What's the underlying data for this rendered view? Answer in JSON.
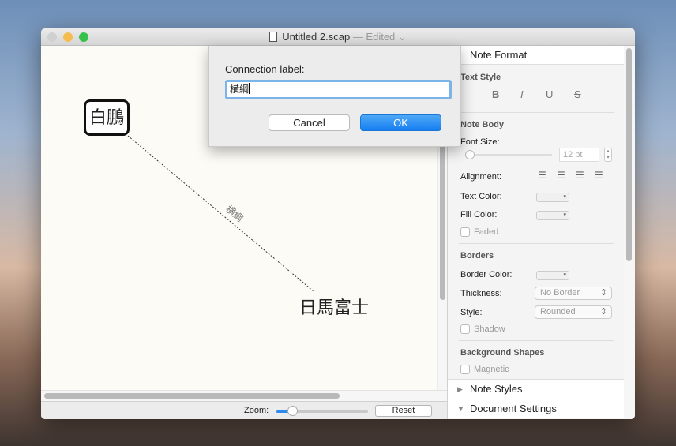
{
  "window": {
    "title": "Untitled 2.scap",
    "status": "— Edited ⌄"
  },
  "canvas": {
    "node1": "白鵬",
    "node2": "日馬富士",
    "connection_label": "横綱"
  },
  "bottom": {
    "zoom_label": "Zoom:",
    "zoom_fraction": 0.15,
    "reset": "Reset"
  },
  "sidebar": {
    "header": "Note Format",
    "text_style": "Text Style",
    "formats": [
      "B",
      "I",
      "U",
      "S"
    ],
    "note_body": "Note Body",
    "font_size": "Font Size:",
    "font_size_value": "12 pt",
    "alignment": "Alignment:",
    "text_color": "Text Color:",
    "fill_color": "Fill Color:",
    "faded": "Faded",
    "borders": "Borders",
    "border_color": "Border Color:",
    "thickness": "Thickness:",
    "thickness_value": "No Border",
    "style": "Style:",
    "style_value": "Rounded",
    "shadow": "Shadow",
    "bg_shapes": "Background Shapes",
    "magnetic": "Magnetic",
    "note_styles": "Note Styles",
    "document_settings": "Document Settings"
  },
  "dialog": {
    "label": "Connection label:",
    "value": "横綱",
    "cancel": "Cancel",
    "ok": "OK"
  }
}
